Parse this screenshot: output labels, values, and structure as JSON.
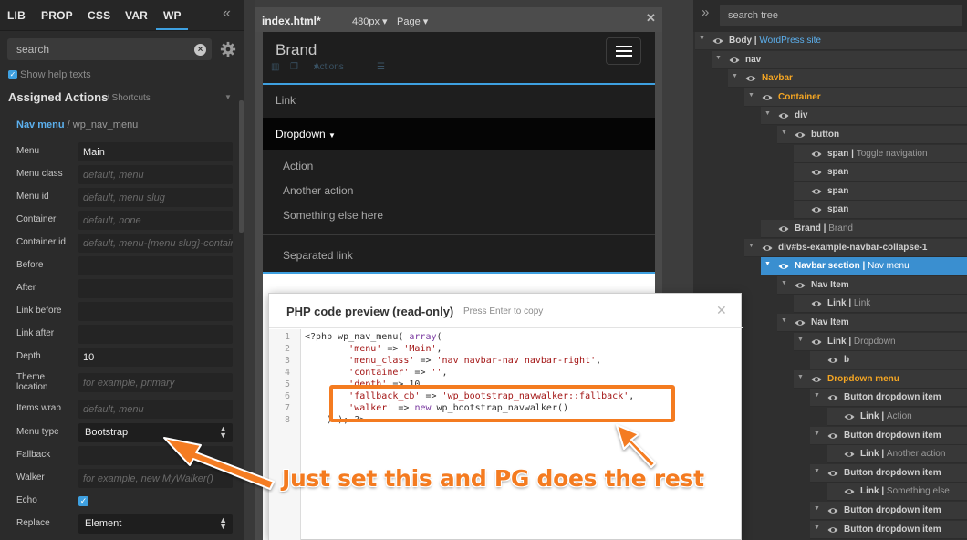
{
  "left_panel": {
    "tabs": [
      "LIB",
      "PROP",
      "CSS",
      "VAR",
      "WP"
    ],
    "search_placeholder": "search",
    "show_help_label": "Show help texts",
    "section_title": "Assigned Actions",
    "section_subtitle": "/ Shortcuts",
    "nav_menu_title": "Nav menu",
    "nav_menu_sub": "/ wp_nav_menu",
    "props": {
      "menu": {
        "label": "Menu",
        "value": "Main"
      },
      "menu_class": {
        "label": "Menu class",
        "placeholder": "default, menu"
      },
      "menu_id": {
        "label": "Menu id",
        "placeholder": "default, menu slug"
      },
      "container": {
        "label": "Container",
        "placeholder": "default, none"
      },
      "container_id": {
        "label": "Container id",
        "placeholder": "default, menu-{menu slug}-container"
      },
      "before": {
        "label": "Before"
      },
      "after": {
        "label": "After"
      },
      "link_before": {
        "label": "Link before"
      },
      "link_after": {
        "label": "Link after"
      },
      "depth": {
        "label": "Depth",
        "value": "10"
      },
      "theme_location": {
        "label": "Theme location",
        "placeholder": "for example, primary"
      },
      "items_wrap": {
        "label": "Items wrap",
        "placeholder": "default, menu"
      },
      "menu_type": {
        "label": "Menu type",
        "value": "Bootstrap"
      },
      "fallback": {
        "label": "Fallback"
      },
      "walker": {
        "label": "Walker",
        "placeholder": "for example, new MyWalker()"
      },
      "echo": {
        "label": "Echo",
        "checked": true
      },
      "replace": {
        "label": "Replace",
        "value": "Element"
      }
    }
  },
  "editor": {
    "file_tab": "index.html*",
    "size_dropdown": "480px",
    "page_dropdown": "Page",
    "toolbar_actions": "Actions",
    "preview": {
      "brand": "Brand",
      "link": "Link",
      "dropdown": "Dropdown",
      "dropdown_items": [
        "Action",
        "Another action",
        "Something else here"
      ],
      "separated_link": "Separated link"
    }
  },
  "php_modal": {
    "title": "PHP code preview (read-only)",
    "subtitle": "Press Enter to copy",
    "code_lines": [
      "<?php wp_nav_menu( array(",
      "        'menu' => 'Main',",
      "        'menu_class' => 'nav navbar-nav navbar-right',",
      "        'container' => '',",
      "        'depth' => 10,",
      "        'fallback_cb' => 'wp_bootstrap_navwalker::fallback',",
      "        'walker' => new wp_bootstrap_navwalker()",
      "    ) ); ?>"
    ],
    "line_numbers": [
      "1",
      "2",
      "3",
      "4",
      "5",
      "6",
      "7",
      "8"
    ]
  },
  "annotation": {
    "text": "Just set this and PG does the rest",
    "color": "#f47b20"
  },
  "tree": {
    "search_placeholder": "search tree",
    "nodes": [
      {
        "tag": "Body",
        "label": "WordPress site",
        "label_color": "blue"
      },
      {
        "tag": "nav"
      },
      {
        "tag": "Navbar",
        "orange": true
      },
      {
        "tag": "Container",
        "orange": true
      },
      {
        "tag": "div"
      },
      {
        "tag": "button"
      },
      {
        "tag": "span",
        "label": "Toggle navigation"
      },
      {
        "tag": "span"
      },
      {
        "tag": "span"
      },
      {
        "tag": "span"
      },
      {
        "tag": "Brand",
        "label": "Brand"
      },
      {
        "tag": "div#bs-example-navbar-collapse-1"
      },
      {
        "tag": "Navbar section",
        "label": "Nav menu",
        "selected": true
      },
      {
        "tag": "Nav Item"
      },
      {
        "tag": "Link",
        "label": "Link"
      },
      {
        "tag": "Nav Item"
      },
      {
        "tag": "Link",
        "label": "Dropdown"
      },
      {
        "tag": "b"
      },
      {
        "tag": "Dropdown menu",
        "orange": true
      },
      {
        "tag": "Button dropdown item"
      },
      {
        "tag": "Link",
        "label": "Action"
      },
      {
        "tag": "Button dropdown item"
      },
      {
        "tag": "Link",
        "label": "Another action"
      },
      {
        "tag": "Button dropdown item"
      },
      {
        "tag": "Link",
        "label": "Something else"
      },
      {
        "tag": "Button dropdown item"
      },
      {
        "tag": "Button dropdown item"
      }
    ]
  },
  "colors": {
    "accent_blue": "#3ea0e0",
    "annotation_orange": "#f47b20",
    "tree_orange": "#f5a623"
  }
}
